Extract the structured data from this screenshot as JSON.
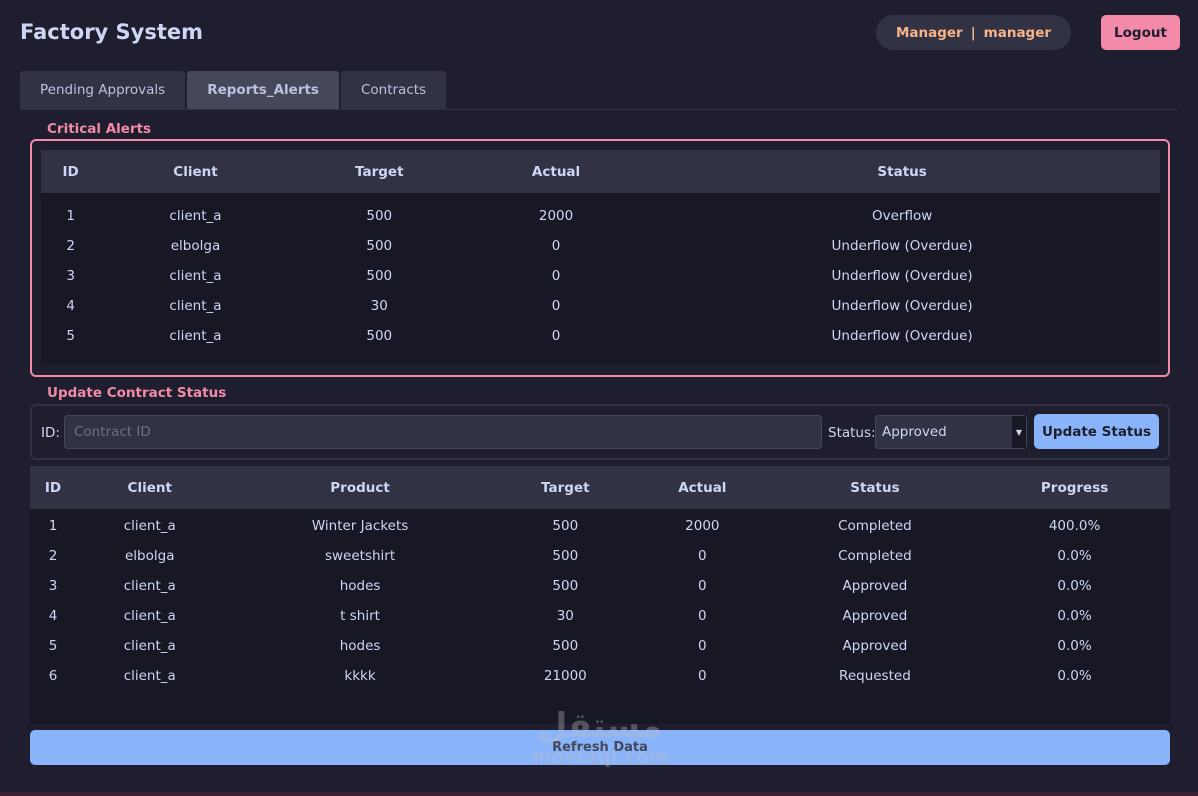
{
  "app": {
    "title": "Factory System",
    "role": "Manager",
    "separator": "|",
    "username": "manager",
    "logout_label": "Logout"
  },
  "tabs": [
    {
      "label": "Pending Approvals",
      "active": false
    },
    {
      "label": "Reports_Alerts",
      "active": true
    },
    {
      "label": "Contracts",
      "active": false
    }
  ],
  "alerts": {
    "title": "Critical Alerts",
    "columns": [
      "ID",
      "Client",
      "Target",
      "Actual",
      "Status"
    ],
    "rows": [
      [
        "1",
        "client_a",
        "500",
        "2000",
        "Overflow"
      ],
      [
        "2",
        "elbolga",
        "500",
        "0",
        "Underflow (Overdue)"
      ],
      [
        "3",
        "client_a",
        "500",
        "0",
        "Underflow (Overdue)"
      ],
      [
        "4",
        "client_a",
        "30",
        "0",
        "Underflow (Overdue)"
      ],
      [
        "5",
        "client_a",
        "500",
        "0",
        "Underflow (Overdue)"
      ]
    ]
  },
  "update": {
    "title": "Update Contract Status",
    "id_label": "ID:",
    "id_placeholder": "Contract ID",
    "id_value": "",
    "status_label": "Status:",
    "status_value": "Approved",
    "button_label": "Update Status"
  },
  "contracts": {
    "columns": [
      "ID",
      "Client",
      "Product",
      "Target",
      "Actual",
      "Status",
      "Progress"
    ],
    "rows": [
      [
        "1",
        "client_a",
        "Winter Jackets",
        "500",
        "2000",
        "Completed",
        "400.0%"
      ],
      [
        "2",
        "elbolga",
        "sweetshirt",
        "500",
        "0",
        "Completed",
        "0.0%"
      ],
      [
        "3",
        "client_a",
        "hodes",
        "500",
        "0",
        "Approved",
        "0.0%"
      ],
      [
        "4",
        "client_a",
        "t shirt",
        "30",
        "0",
        "Approved",
        "0.0%"
      ],
      [
        "5",
        "client_a",
        "hodes",
        "500",
        "0",
        "Approved",
        "0.0%"
      ],
      [
        "6",
        "client_a",
        "kkkk",
        "21000",
        "0",
        "Requested",
        "0.0%"
      ]
    ]
  },
  "refresh_label": "Refresh Data",
  "watermark": {
    "arabic": "مستقل",
    "latin": "mostaql.com"
  },
  "colors": {
    "background": "#1e1e2e",
    "accent_pink": "#f38ba8",
    "accent_blue": "#89b4fa",
    "accent_peach": "#fab387"
  }
}
